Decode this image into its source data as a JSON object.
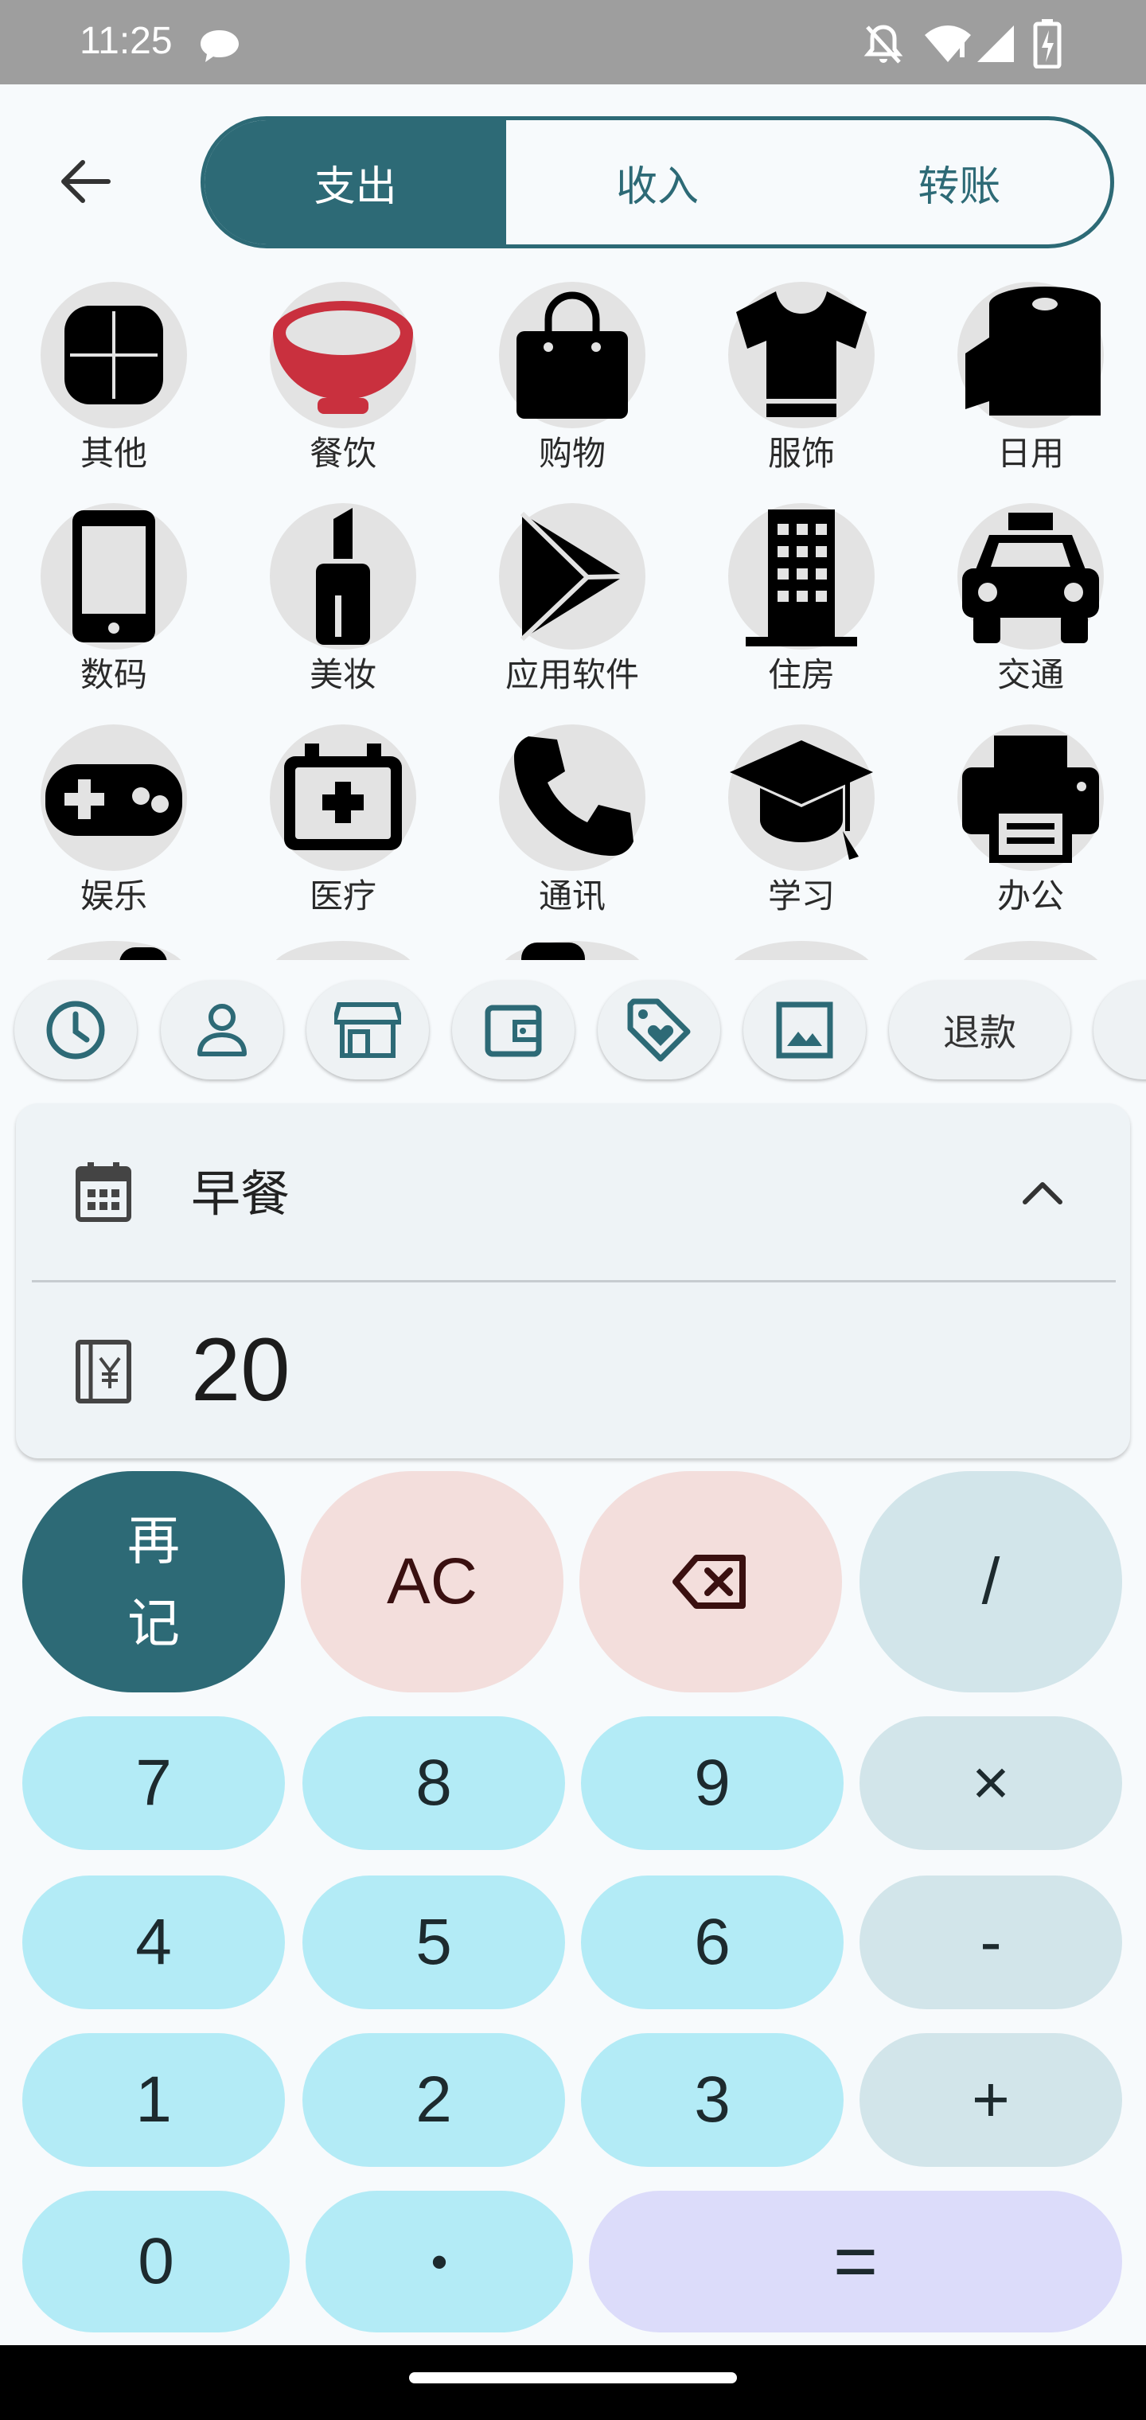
{
  "status_bar": {
    "time": "11:25",
    "icons": [
      "chat-bubble-icon",
      "mute-icon",
      "wifi-icon",
      "signal-icon",
      "battery-charging-icon"
    ]
  },
  "top_bar": {
    "back_icon": "arrow-left-icon",
    "tabs": [
      {
        "label": "支出",
        "active": true
      },
      {
        "label": "收入",
        "active": false
      },
      {
        "label": "转账",
        "active": false
      }
    ]
  },
  "categories": [
    {
      "label": "其他",
      "icon": "clover-icon"
    },
    {
      "label": "餐饮",
      "icon": "bowl-icon"
    },
    {
      "label": "购物",
      "icon": "shopping-bag-icon"
    },
    {
      "label": "服饰",
      "icon": "shirt-icon"
    },
    {
      "label": "日用",
      "icon": "paper-roll-icon"
    },
    {
      "label": "数码",
      "icon": "phone-icon"
    },
    {
      "label": "美妆",
      "icon": "lipstick-icon"
    },
    {
      "label": "应用软件",
      "icon": "play-store-icon"
    },
    {
      "label": "住房",
      "icon": "building-icon"
    },
    {
      "label": "交通",
      "icon": "taxi-icon"
    },
    {
      "label": "娱乐",
      "icon": "gamepad-icon"
    },
    {
      "label": "医疗",
      "icon": "medical-kit-icon"
    },
    {
      "label": "通讯",
      "icon": "telephone-icon"
    },
    {
      "label": "学习",
      "icon": "graduation-cap-icon"
    },
    {
      "label": "办公",
      "icon": "printer-icon"
    }
  ],
  "chips": [
    {
      "icon": "clock-icon"
    },
    {
      "icon": "person-icon"
    },
    {
      "icon": "store-icon"
    },
    {
      "icon": "wallet-icon"
    },
    {
      "icon": "tag-heart-icon"
    },
    {
      "icon": "image-icon"
    },
    {
      "label": "退款"
    }
  ],
  "note": {
    "icon": "calendar-icon",
    "text": "早餐",
    "collapse_icon": "chevron-up-icon"
  },
  "amount": {
    "icon": "yuan-book-icon",
    "value": "20"
  },
  "keypad": {
    "again": "再\n记",
    "clear": "AC",
    "backspace_icon": "backspace-icon",
    "divide": "/",
    "k7": "7",
    "k8": "8",
    "k9": "9",
    "multiply": "×",
    "k4": "4",
    "k5": "5",
    "k6": "6",
    "minus": "-",
    "k1": "1",
    "k2": "2",
    "k3": "3",
    "plus": "+",
    "k0": "0",
    "dot": "•",
    "equals": "="
  },
  "colors": {
    "primary": "#2d6a76",
    "num_key": "#b3ebf6",
    "op_key": "#d2e5ea",
    "danger_key": "#f3dedc",
    "equals_key": "#dcdcfa",
    "dining_icon": "#c9303e"
  }
}
